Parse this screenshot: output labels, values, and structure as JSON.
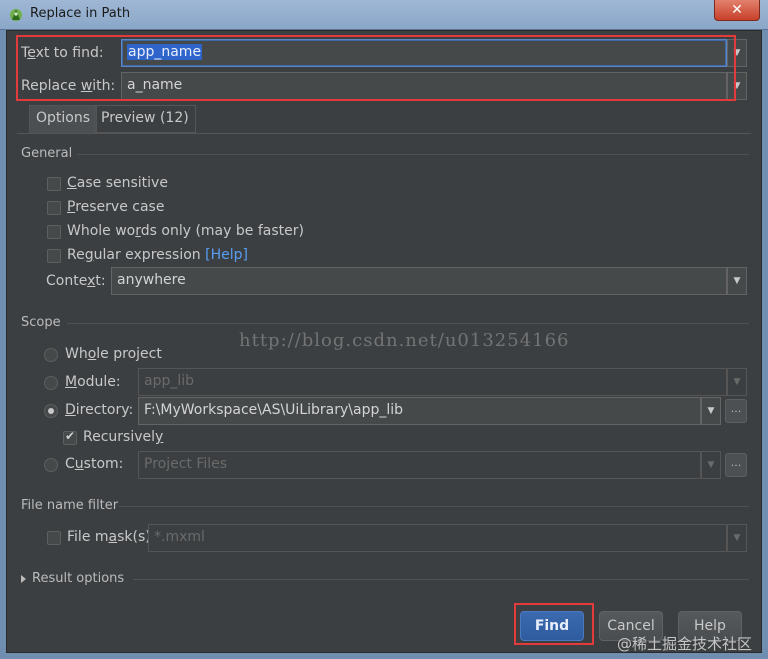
{
  "window": {
    "title": "Replace in Path",
    "close_label": "✕"
  },
  "find": {
    "label_pre": "T",
    "label_ul": "e",
    "label_post": "xt to find:",
    "value": "app_name"
  },
  "replace": {
    "label_pre": "Replace ",
    "label_ul": "w",
    "label_post": "ith:",
    "value": "a_name"
  },
  "tabs": [
    {
      "label": "Options"
    },
    {
      "label": "Preview (12)"
    }
  ],
  "general": {
    "title": "General",
    "options": [
      {
        "pre": "",
        "ul": "C",
        "post": "ase sensitive"
      },
      {
        "pre": "",
        "ul": "P",
        "post": "reserve case"
      },
      {
        "pre": "Whole wo",
        "ul": "r",
        "post": "ds only (may be faster)"
      },
      {
        "pre": "Re",
        "ul": "g",
        "post": "ular expression"
      }
    ],
    "help_link": "[Help]",
    "context_label_pre": "Conte",
    "context_label_ul": "x",
    "context_label_post": "t:",
    "context_value": "anywhere"
  },
  "scope": {
    "title": "Scope",
    "whole_project": {
      "pre": "Wh",
      "ul": "o",
      "post": "le project"
    },
    "module": {
      "pre": "",
      "ul": "M",
      "post": "odule:",
      "value": "app_lib"
    },
    "directory": {
      "pre": "",
      "ul": "D",
      "post": "irectory:",
      "value": "F:\\MyWorkspace\\AS\\UiLibrary\\app_lib"
    },
    "recursively": {
      "pre": "Recursivel",
      "ul": "y",
      "post": ""
    },
    "custom": {
      "pre": "C",
      "ul": "u",
      "post": "stom:",
      "value": "Project Files"
    },
    "browse_label": "..."
  },
  "file_filter": {
    "title": "File name filter",
    "mask_pre": "File m",
    "mask_ul": "a",
    "mask_post": "sk(s)",
    "mask_value": "*.mxml"
  },
  "result_options": {
    "label": "Result options"
  },
  "buttons": {
    "find": "Find",
    "cancel": "Cancel",
    "help": "Help"
  },
  "watermarks": {
    "center": "http://blog.csdn.net/u013254166",
    "corner": "@稀土掘金技术社区"
  },
  "colors": {
    "accent": "#2f65ca",
    "highlight_box": "#e33b3b",
    "background": "#3c3f41"
  }
}
